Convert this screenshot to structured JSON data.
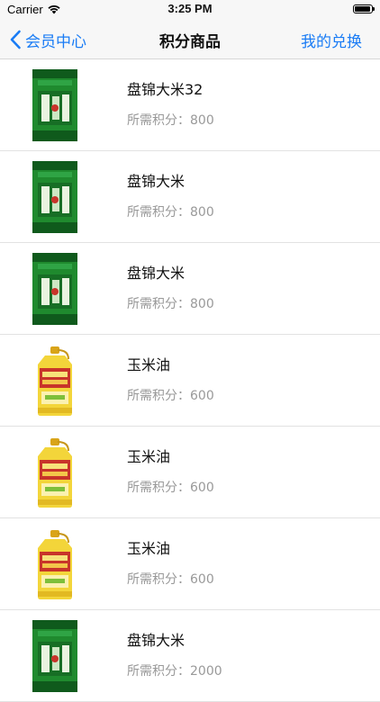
{
  "status_bar": {
    "carrier": "Carrier",
    "time": "3:25 PM"
  },
  "nav": {
    "back_label": "会员中心",
    "title": "积分商品",
    "right_label": "我的兑换"
  },
  "items": [
    {
      "name": "盘锦大米32",
      "points_text": "所需积分：800",
      "image": "rice-bag"
    },
    {
      "name": "盘锦大米",
      "points_text": "所需积分：800",
      "image": "rice-bag"
    },
    {
      "name": "盘锦大米",
      "points_text": "所需积分：800",
      "image": "rice-bag"
    },
    {
      "name": "玉米油",
      "points_text": "所需积分：600",
      "image": "oil-bottle"
    },
    {
      "name": "玉米油",
      "points_text": "所需积分：600",
      "image": "oil-bottle"
    },
    {
      "name": "玉米油",
      "points_text": "所需积分：600",
      "image": "oil-bottle"
    },
    {
      "name": "盘锦大米",
      "points_text": "所需积分：2000",
      "image": "rice-bag"
    }
  ],
  "colors": {
    "accent": "#1a7cf5",
    "secondary_text": "#999999",
    "rice_green": "#1f8a2e",
    "oil_yellow": "#e6c21a"
  }
}
